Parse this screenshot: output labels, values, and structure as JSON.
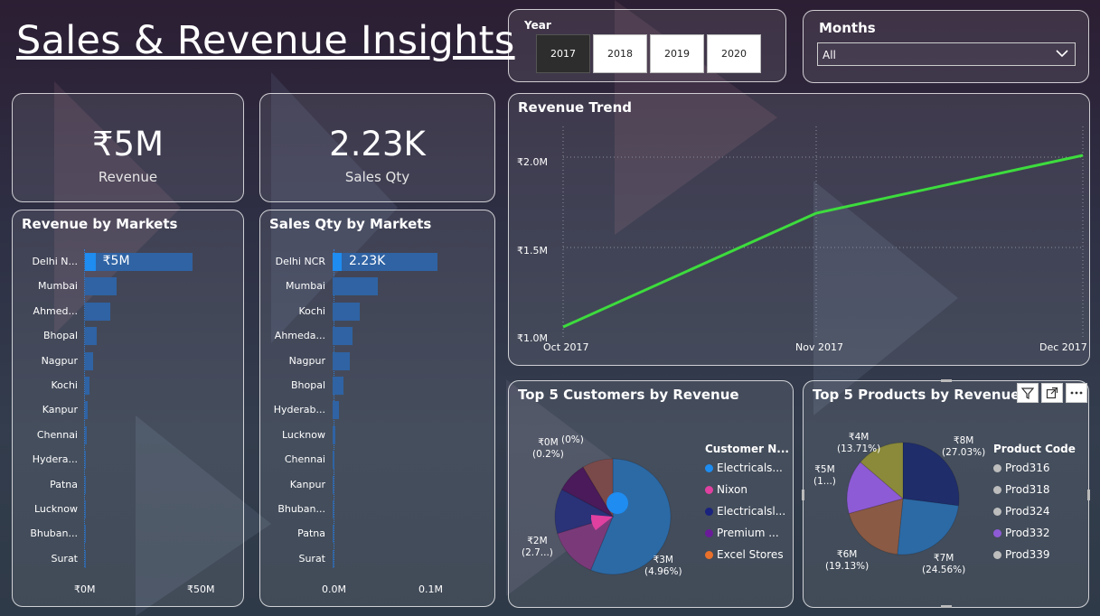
{
  "header": {
    "title": "Sales & Revenue Insights"
  },
  "kpis": {
    "revenue": {
      "value": "₹5M",
      "label": "Revenue"
    },
    "sales_qty": {
      "value": "2.23K",
      "label": "Sales Qty"
    }
  },
  "year_filter": {
    "label": "Year",
    "options": [
      "2017",
      "2018",
      "2019",
      "2020"
    ],
    "selected": "2017"
  },
  "months_filter": {
    "label": "Months",
    "value": "All"
  },
  "revenue_by_markets": {
    "title": "Revenue by Markets",
    "markets": [
      "Delhi N...",
      "Mumbai",
      "Ahmed...",
      "Bhopal",
      "Nagpur",
      "Kochi",
      "Kanpur",
      "Chennai",
      "Hydera...",
      "Patna",
      "Lucknow",
      "Bhuban...",
      "Surat"
    ],
    "data_label": "₹5M",
    "x_ticks": [
      "₹0M",
      "₹50M"
    ]
  },
  "sales_qty_by_markets": {
    "title": "Sales Qty by Markets",
    "markets": [
      "Delhi NCR",
      "Mumbai",
      "Kochi",
      "Ahmeda...",
      "Nagpur",
      "Bhopal",
      "Hyderab...",
      "Lucknow",
      "Chennai",
      "Kanpur",
      "Bhuban...",
      "Patna",
      "Surat"
    ],
    "data_label": "2.23K",
    "x_ticks": [
      "0.0M",
      "0.1M"
    ]
  },
  "revenue_trend": {
    "title": "Revenue Trend",
    "y_ticks": [
      "₹2.0M",
      "₹1.5M",
      "₹1.0M"
    ],
    "x_ticks": [
      "Oct 2017",
      "Nov 2017",
      "Dec 2017"
    ]
  },
  "top_customers": {
    "title": "Top 5 Customers by Revenue",
    "legend_title": "Customer N...",
    "legend": [
      {
        "name": "Electricals...",
        "color": "#1e8cf0"
      },
      {
        "name": "Nixon",
        "color": "#e040a0"
      },
      {
        "name": "Electricalsl...",
        "color": "#1a237e"
      },
      {
        "name": "Premium ...",
        "color": "#6a1b9a"
      },
      {
        "name": "Excel Stores",
        "color": "#e8702a"
      }
    ],
    "labels": [
      "₹0M",
      "(0.2%)",
      "(0%)",
      "₹2M",
      "(2.7...)",
      "₹3M",
      "(4.96%)"
    ]
  },
  "top_products": {
    "title": "Top 5 Products by Revenue",
    "legend_title": "Product Code",
    "legend": [
      {
        "name": "Prod316",
        "color": "#bdbdbd"
      },
      {
        "name": "Prod318",
        "color": "#bdbdbd"
      },
      {
        "name": "Prod324",
        "color": "#bdbdbd"
      },
      {
        "name": "Prod332",
        "color": "#8e5bd6"
      },
      {
        "name": "Prod339",
        "color": "#bdbdbd"
      }
    ],
    "labels": [
      "₹4M",
      "(13.71%)",
      "₹8M",
      "(27.03%)",
      "₹5M",
      "(1...)",
      "₹6M",
      "(19.13%)",
      "₹7M",
      "(24.56%)"
    ]
  },
  "chart_data": [
    {
      "type": "bar",
      "title": "Revenue by Markets",
      "orientation": "horizontal",
      "categories": [
        "Delhi N...",
        "Mumbai",
        "Ahmed...",
        "Bhopal",
        "Nagpur",
        "Kochi",
        "Kanpur",
        "Chennai",
        "Hydera...",
        "Patna",
        "Lucknow",
        "Bhuban...",
        "Surat"
      ],
      "values": [
        51,
        15,
        12,
        5.5,
        4,
        2,
        1.5,
        1,
        0.5,
        0.15,
        0.1,
        0.05,
        0.02
      ],
      "highlight_values": [
        5,
        0,
        0,
        0,
        0,
        0,
        0,
        0,
        0,
        0,
        0,
        0,
        0
      ],
      "xlim": [
        0,
        55
      ],
      "unit": "₹M"
    },
    {
      "type": "bar",
      "title": "Sales Qty by Markets",
      "orientation": "horizontal",
      "categories": [
        "Delhi NCR",
        "Mumbai",
        "Kochi",
        "Ahmeda...",
        "Nagpur",
        "Bhopal",
        "Hyderab...",
        "Lucknow",
        "Chennai",
        "Kanpur",
        "Bhuban...",
        "Patna",
        "Surat"
      ],
      "values": [
        0.1,
        0.043,
        0.026,
        0.019,
        0.016,
        0.01,
        0.006,
        0.003,
        0.002,
        0.001,
        0.0007,
        0.0004,
        0.0002
      ],
      "highlight_values": [
        0.00223,
        0,
        0,
        0,
        0,
        0,
        0,
        0,
        0,
        0,
        0,
        0,
        0
      ],
      "xlim": [
        0,
        0.11
      ],
      "unit": "M"
    },
    {
      "type": "line",
      "title": "Revenue Trend",
      "x": [
        "Oct 2017",
        "Nov 2017",
        "Dec 2017"
      ],
      "series": [
        {
          "values": [
            1.06,
            1.69,
            2.01
          ],
          "color": "#3ddc3d"
        }
      ],
      "ylim": [
        1.0,
        2.2
      ],
      "unit": "₹M",
      "grid": true
    },
    {
      "type": "pie",
      "title": "Top 5 Customers by Revenue",
      "slices": [
        {
          "label": "Electricals...",
          "value": 3,
          "color": "#1e8cf0"
        },
        {
          "label": "Nixon",
          "value": 0.4,
          "color": "#e040a0"
        },
        {
          "label": "Electricalsl...",
          "value": 0.55,
          "color": "#1a237e"
        },
        {
          "label": "Premium ...",
          "value": 0.3,
          "color": "#6a1b9a"
        },
        {
          "label": "Excel Stores",
          "value": 0.01,
          "color": "#e8702a"
        }
      ]
    },
    {
      "type": "pie",
      "title": "Top 5 Products by Revenue",
      "slices": [
        {
          "label": "Prod316",
          "value": 27.03,
          "color": "#1f2d6b"
        },
        {
          "label": "Prod318",
          "value": 24.56,
          "color": "#2c6aa6"
        },
        {
          "label": "Prod324",
          "value": 19.13,
          "color": "#8a5a44"
        },
        {
          "label": "Prod332",
          "value": 15.57,
          "color": "#8e5bd6"
        },
        {
          "label": "Prod339",
          "value": 13.71,
          "color": "#8a8a3a"
        }
      ]
    }
  ]
}
